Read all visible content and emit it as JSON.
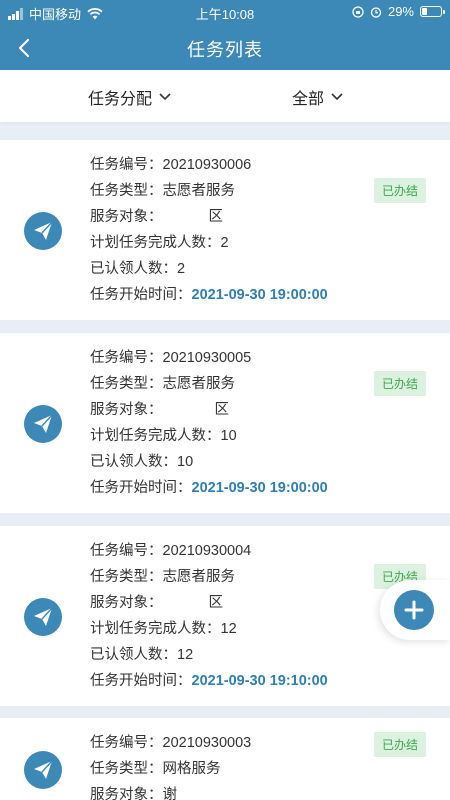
{
  "status_bar": {
    "carrier": "中国移动",
    "time": "上午10:08",
    "battery": "29%",
    "battery_level": 0.29
  },
  "header": {
    "title": "任务列表",
    "back_icon": "chevron-left-icon"
  },
  "filters": {
    "assign_label": "任务分配",
    "status_label": "全部"
  },
  "colors": {
    "primary": "#3c88b6",
    "badge_bg": "#dcf1df",
    "badge_text": "#3da64c",
    "time_text": "#2f7fb0"
  },
  "tasks": [
    {
      "number_label": "任务编号：",
      "number": "20210930006",
      "type_label": "任务类型：",
      "type": "志愿者服务",
      "target_label": "服务对象：",
      "target": "区",
      "plan_label": "计划任务完成人数：",
      "plan": "2",
      "claimed_label": "已认领人数：",
      "claimed": "2",
      "start_label": "任务开始时间：",
      "start": "2021-09-30 19:00:00",
      "status": "已办结"
    },
    {
      "number_label": "任务编号：",
      "number": "20210930005",
      "type_label": "任务类型：",
      "type": "志愿者服务",
      "target_label": "服务对象：",
      "target": "区",
      "plan_label": "计划任务完成人数：",
      "plan": "10",
      "claimed_label": "已认领人数：",
      "claimed": "10",
      "start_label": "任务开始时间：",
      "start": "2021-09-30 19:00:00",
      "status": "已办结"
    },
    {
      "number_label": "任务编号：",
      "number": "20210930004",
      "type_label": "任务类型：",
      "type": "志愿者服务",
      "target_label": "服务对象：",
      "target": "区",
      "plan_label": "计划任务完成人数：",
      "plan": "12",
      "claimed_label": "已认领人数：",
      "claimed": "12",
      "start_label": "任务开始时间：",
      "start": "2021-09-30 19:10:00",
      "status": "已办结"
    },
    {
      "number_label": "任务编号：",
      "number": "20210930003",
      "type_label": "任务类型：",
      "type": "网格服务",
      "target_label": "服务对象：",
      "target": "谢",
      "status": "已办结"
    }
  ]
}
